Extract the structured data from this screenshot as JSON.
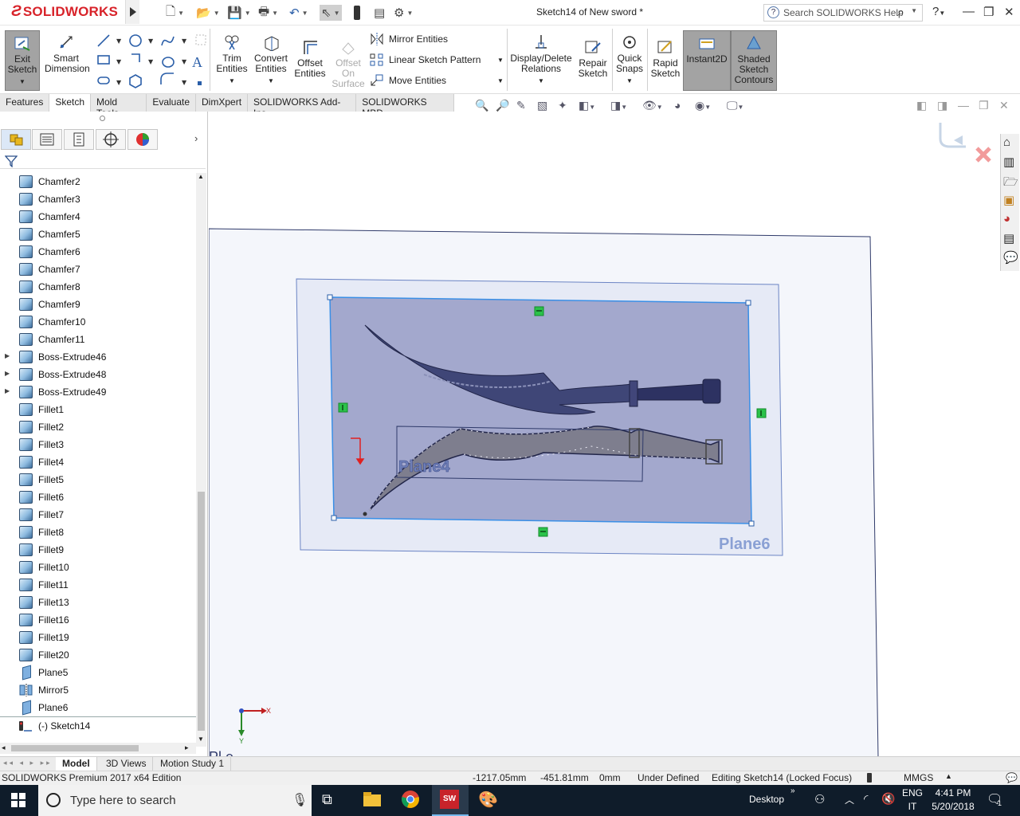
{
  "app": {
    "logo_text": "SOLIDWORKS",
    "window_title": "Sketch14 of New sword *",
    "help_search_placeholder": "Search SOLIDWORKS Help"
  },
  "ribbon": {
    "exit_sketch": "Exit Sketch",
    "smart_dimension": "Smart Dimension",
    "trim_entities": "Trim Entities",
    "convert_entities": "Convert Entities",
    "offset_entities": "Offset Entities",
    "offset_on_surface": "Offset On Surface",
    "mirror_entities": "Mirror Entities",
    "linear_sketch_pattern": "Linear Sketch Pattern",
    "move_entities": "Move Entities",
    "display_delete_relations": "Display/Delete Relations",
    "repair_sketch": "Repair Sketch",
    "quick_snaps": "Quick Snaps",
    "rapid_sketch": "Rapid Sketch",
    "instant2d": "Instant2D",
    "shaded_sketch_contours": "Shaded Sketch Contours"
  },
  "tabs": [
    "Features",
    "Sketch",
    "Mold Tools",
    "Evaluate",
    "DimXpert",
    "SOLIDWORKS Add-Ins",
    "SOLIDWORKS MBD"
  ],
  "active_tab": "Sketch",
  "tree": [
    {
      "label": "Chamfer2",
      "type": "feature",
      "expandable": false
    },
    {
      "label": "Chamfer3",
      "type": "feature",
      "expandable": false
    },
    {
      "label": "Chamfer4",
      "type": "feature",
      "expandable": false
    },
    {
      "label": "Chamfer5",
      "type": "feature",
      "expandable": false
    },
    {
      "label": "Chamfer6",
      "type": "feature",
      "expandable": false
    },
    {
      "label": "Chamfer7",
      "type": "feature",
      "expandable": false
    },
    {
      "label": "Chamfer8",
      "type": "feature",
      "expandable": false
    },
    {
      "label": "Chamfer9",
      "type": "feature",
      "expandable": false
    },
    {
      "label": "Chamfer10",
      "type": "feature",
      "expandable": false
    },
    {
      "label": "Chamfer11",
      "type": "feature",
      "expandable": false
    },
    {
      "label": "Boss-Extrude46",
      "type": "feature",
      "expandable": true
    },
    {
      "label": "Boss-Extrude48",
      "type": "feature",
      "expandable": true
    },
    {
      "label": "Boss-Extrude49",
      "type": "feature",
      "expandable": true
    },
    {
      "label": "Fillet1",
      "type": "feature",
      "expandable": false
    },
    {
      "label": "Fillet2",
      "type": "feature",
      "expandable": false
    },
    {
      "label": "Fillet3",
      "type": "feature",
      "expandable": false
    },
    {
      "label": "Fillet4",
      "type": "feature",
      "expandable": false
    },
    {
      "label": "Fillet5",
      "type": "feature",
      "expandable": false
    },
    {
      "label": "Fillet6",
      "type": "feature",
      "expandable": false
    },
    {
      "label": "Fillet7",
      "type": "feature",
      "expandable": false
    },
    {
      "label": "Fillet8",
      "type": "feature",
      "expandable": false
    },
    {
      "label": "Fillet9",
      "type": "feature",
      "expandable": false
    },
    {
      "label": "Fillet10",
      "type": "feature",
      "expandable": false
    },
    {
      "label": "Fillet11",
      "type": "feature",
      "expandable": false
    },
    {
      "label": "Fillet13",
      "type": "feature",
      "expandable": false
    },
    {
      "label": "Fillet16",
      "type": "feature",
      "expandable": false
    },
    {
      "label": "Fillet19",
      "type": "feature",
      "expandable": false
    },
    {
      "label": "Fillet20",
      "type": "feature",
      "expandable": false
    },
    {
      "label": "Plane5",
      "type": "plane",
      "expandable": false
    },
    {
      "label": "Mirror5",
      "type": "mirror",
      "expandable": false
    },
    {
      "label": "Plane6",
      "type": "plane",
      "expandable": false
    },
    {
      "label": "(-) Sketch14",
      "type": "sketch",
      "expandable": false
    }
  ],
  "viewport": {
    "plane4_label": "Plane4",
    "plane6_label": "Plane6",
    "axis_x": "X",
    "axis_y": "Y"
  },
  "bottom_tabs": [
    "Model",
    "3D Views",
    "Motion Study 1"
  ],
  "active_bottom_tab": "Model",
  "status": {
    "edition": "SOLIDWORKS Premium 2017 x64 Edition",
    "x": "-1217.05mm",
    "y": "-451.81mm",
    "z": "0mm",
    "sketch_state": "Under Defined",
    "editing": "Editing Sketch14 (Locked Focus)",
    "units": "MMGS"
  },
  "taskbar": {
    "search_placeholder": "Type here to search",
    "desktop": "Desktop",
    "lang": "ENG",
    "lang_region": "IT",
    "time": "4:41 PM",
    "date": "5/20/2018",
    "notification_count": "1"
  },
  "colors": {
    "accent_red": "#d8232a",
    "plane_fill": "#ebeef7",
    "plane_edge": "#4a67a8",
    "sketch_fill": "#a2a8cc",
    "selection_blue": "#3a8fe6",
    "taskbar": "#0f1c2a"
  }
}
